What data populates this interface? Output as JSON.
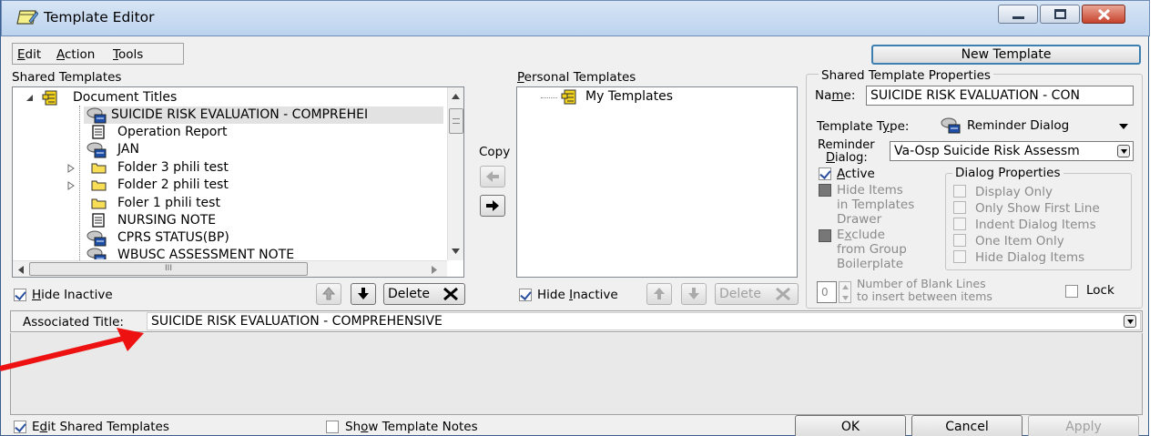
{
  "window": {
    "title": "Template Editor",
    "new_template_label": "New Template"
  },
  "menu": [
    {
      "label": "Edit"
    },
    {
      "label": "Action"
    },
    {
      "label": "Tools"
    }
  ],
  "shared": {
    "header": "Shared Templates",
    "items": [
      {
        "label": "Document Titles",
        "icon": "drawer-icon"
      },
      {
        "label": "SUICIDE RISK EVALUATION - COMPREHEI",
        "icon": "reminder-dialog-icon"
      },
      {
        "label": "Operation Report",
        "icon": "document-icon"
      },
      {
        "label": "JAN",
        "icon": "reminder-dialog-icon"
      },
      {
        "label": "Folder 3 phili test",
        "icon": "folder-icon"
      },
      {
        "label": "Folder 2 phili test",
        "icon": "folder-icon"
      },
      {
        "label": "Foler 1 phili test",
        "icon": "folder-icon"
      },
      {
        "label": "NURSING NOTE",
        "icon": "document-icon"
      },
      {
        "label": "CPRS STATUS(BP)",
        "icon": "reminder-dialog-icon"
      },
      {
        "label": "WBUSC ASSESSMENT NOTE",
        "icon": "reminder-dialog-icon"
      }
    ],
    "hide_inactive": "Hide Inactive",
    "delete": "Delete",
    "hscroll_grip": "III"
  },
  "copy_label": "Copy",
  "personal": {
    "header": "Personal Templates",
    "items": [
      {
        "label": "My Templates",
        "icon": "drawer-icon"
      }
    ],
    "hide_inactive": "Hide Inactive",
    "delete": "Delete"
  },
  "props": {
    "header": "Shared Template Properties",
    "name_label": "Name:",
    "name_value": "SUICIDE RISK EVALUATION - CON",
    "type_label": "Template Type:",
    "type_value": "Reminder Dialog",
    "reminder_label_1": "Reminder",
    "reminder_label_2": "Dialog:",
    "reminder_value": "Va-Osp Suicide Risk Assessm",
    "active": "Active",
    "hide_items": [
      "Hide Items",
      "in Templates",
      "Drawer"
    ],
    "exclude": [
      "Exclude",
      "from Group",
      "Boilerplate"
    ],
    "dialog_props_header": "Dialog Properties",
    "dialog_props": [
      "Display Only",
      "Only Show First Line",
      "Indent Dialog Items",
      "One Item Only",
      "Hide Dialog Items"
    ],
    "blank_lines_value": "0",
    "blank_lines_label": [
      "Number of Blank Lines",
      "to insert between items"
    ],
    "lock": "Lock"
  },
  "associated": {
    "label": "Associated Title:",
    "value": "SUICIDE RISK EVALUATION - COMPREHENSIVE"
  },
  "footer": {
    "edit_shared": "Edit Shared Templates",
    "show_notes": "Show Template Notes",
    "ok": "OK",
    "cancel": "Cancel",
    "apply": "Apply"
  },
  "colors": {
    "arrow": "#ee1111",
    "selection": "#e2e2e2"
  }
}
